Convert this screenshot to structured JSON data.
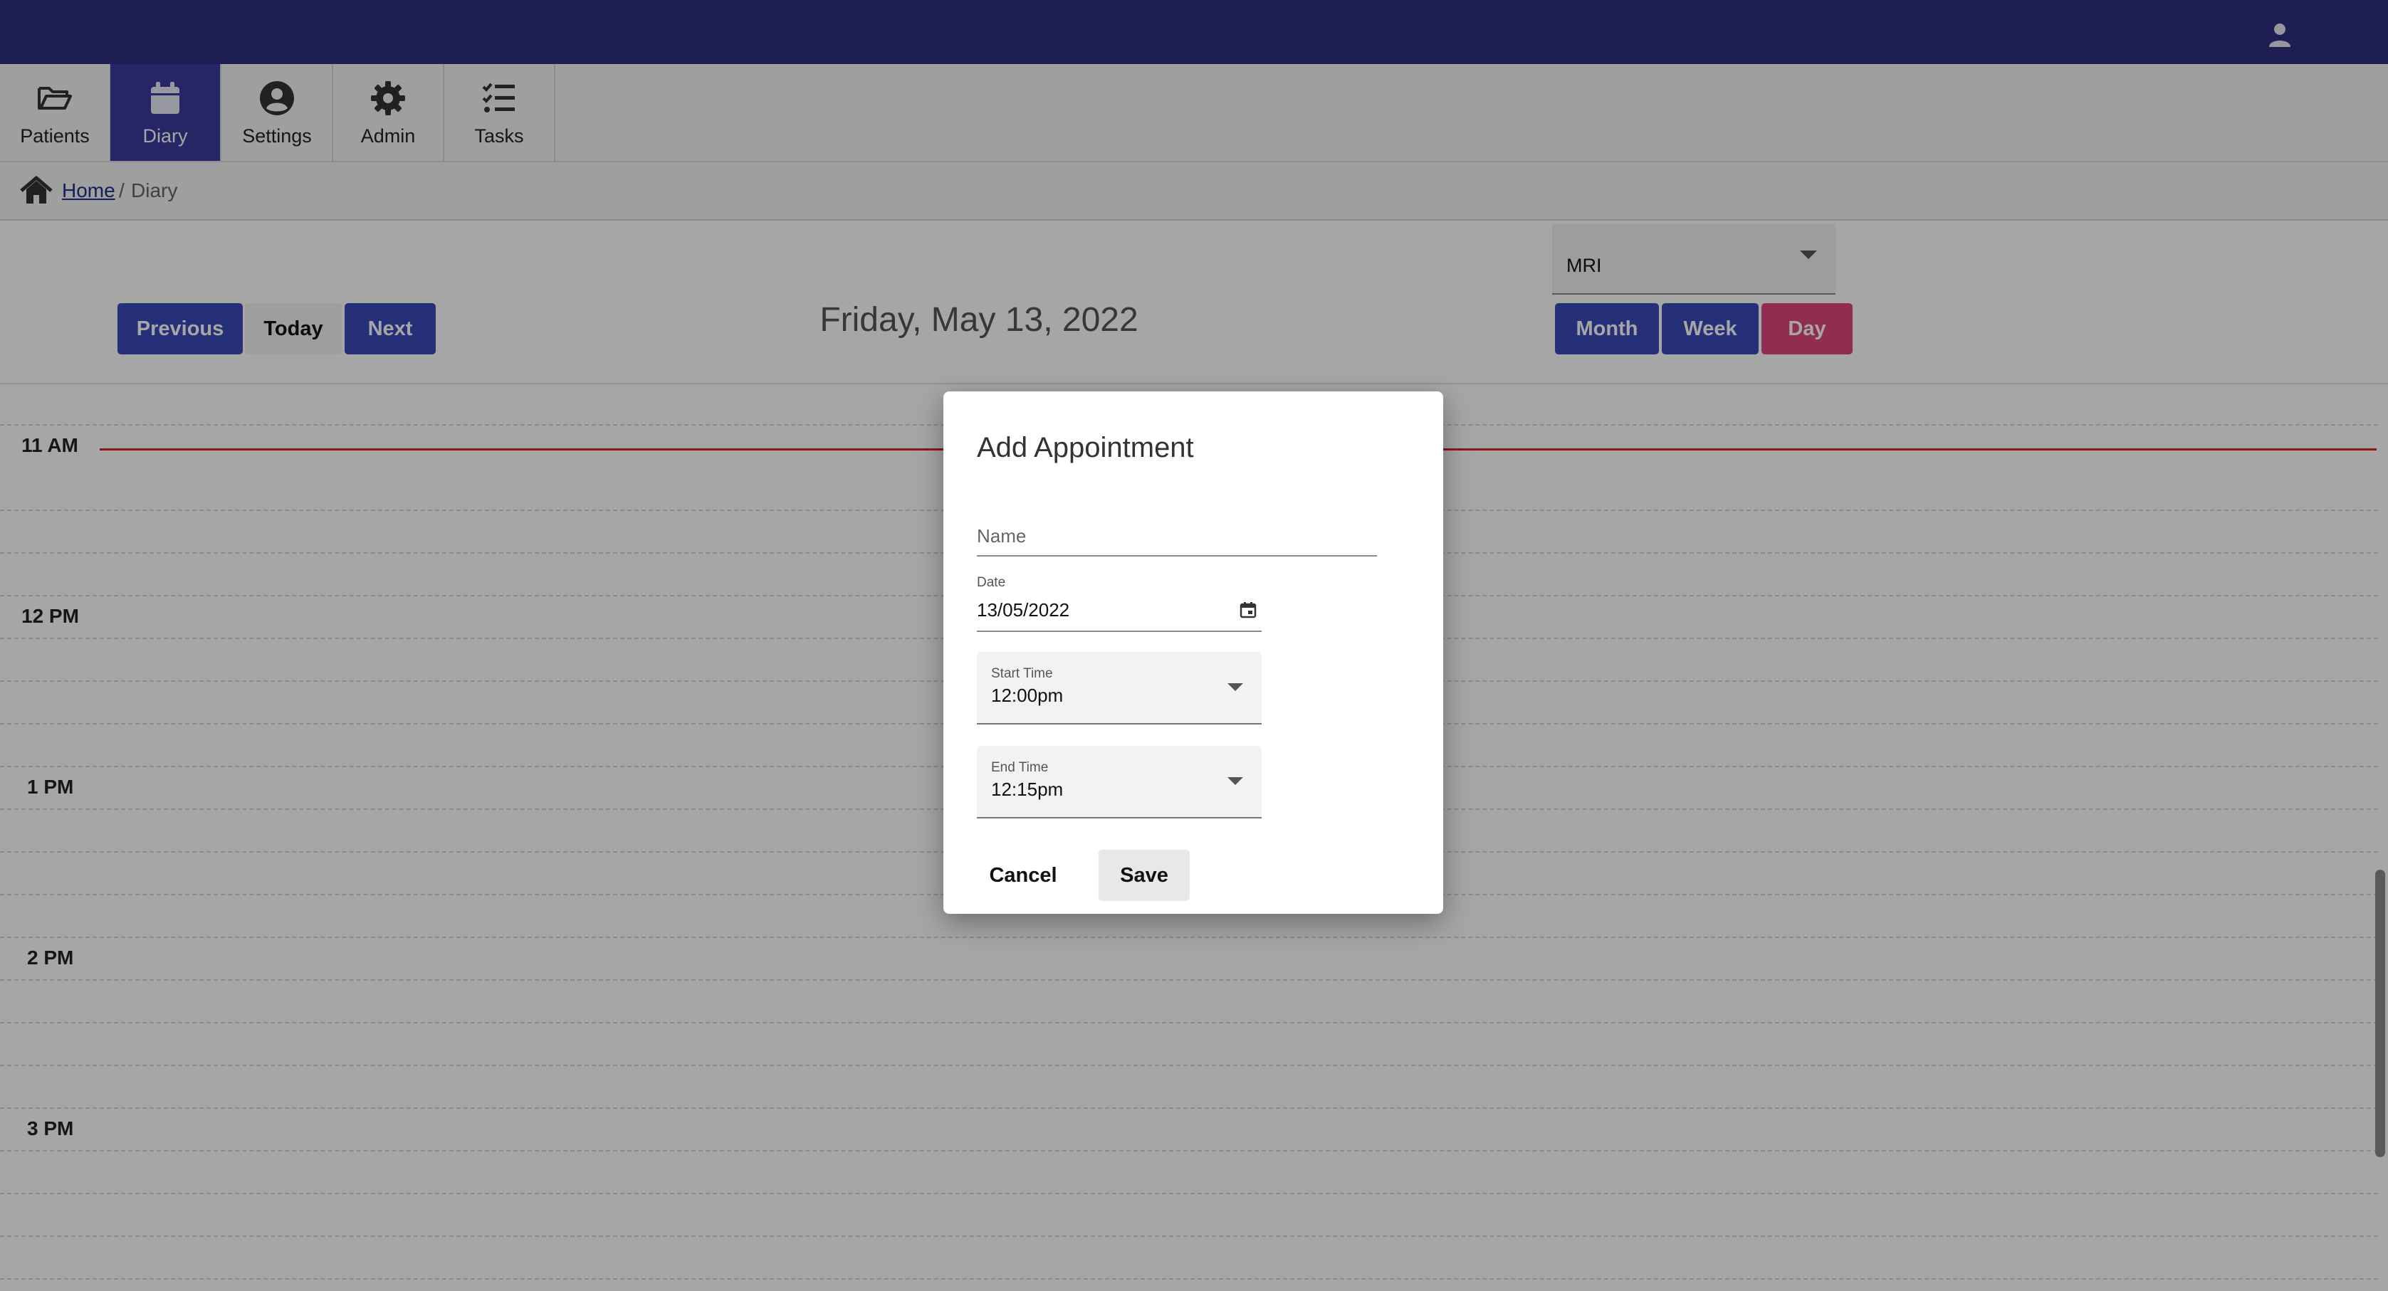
{
  "header": {
    "user_icon": "user-icon"
  },
  "nav": {
    "items": [
      {
        "label": "Patients",
        "icon": "folder-open-icon",
        "active": false
      },
      {
        "label": "Diary",
        "icon": "calendar-icon",
        "active": true
      },
      {
        "label": "Settings",
        "icon": "user-circle-icon",
        "active": false
      },
      {
        "label": "Admin",
        "icon": "gear-icon",
        "active": false
      },
      {
        "label": "Tasks",
        "icon": "task-list-icon",
        "active": false
      }
    ]
  },
  "breadcrumb": {
    "home_label": "Home",
    "separator": "/",
    "current": "Diary"
  },
  "toolbar": {
    "previous_label": "Previous",
    "today_label": "Today",
    "next_label": "Next",
    "date_title": "Friday, May 13, 2022",
    "resource_value": "MRI",
    "views": {
      "month": "Month",
      "week": "Week",
      "day": "Day",
      "active": "Day"
    }
  },
  "calendar": {
    "hours": [
      "11 AM",
      "12 PM",
      "1 PM",
      "2 PM",
      "3 PM"
    ],
    "now_line_color": "#dd2222"
  },
  "modal": {
    "title": "Add Appointment",
    "name_placeholder": "Name",
    "date_label": "Date",
    "date_value": "13/05/2022",
    "start_label": "Start Time",
    "start_value": "12:00pm",
    "end_label": "End Time",
    "end_value": "12:15pm",
    "cancel_label": "Cancel",
    "save_label": "Save"
  },
  "colors": {
    "topbar": "#2e2d82",
    "active_nav": "#3b3a9c",
    "primary_button": "#3b4bb8",
    "active_view": "#e0457e"
  }
}
